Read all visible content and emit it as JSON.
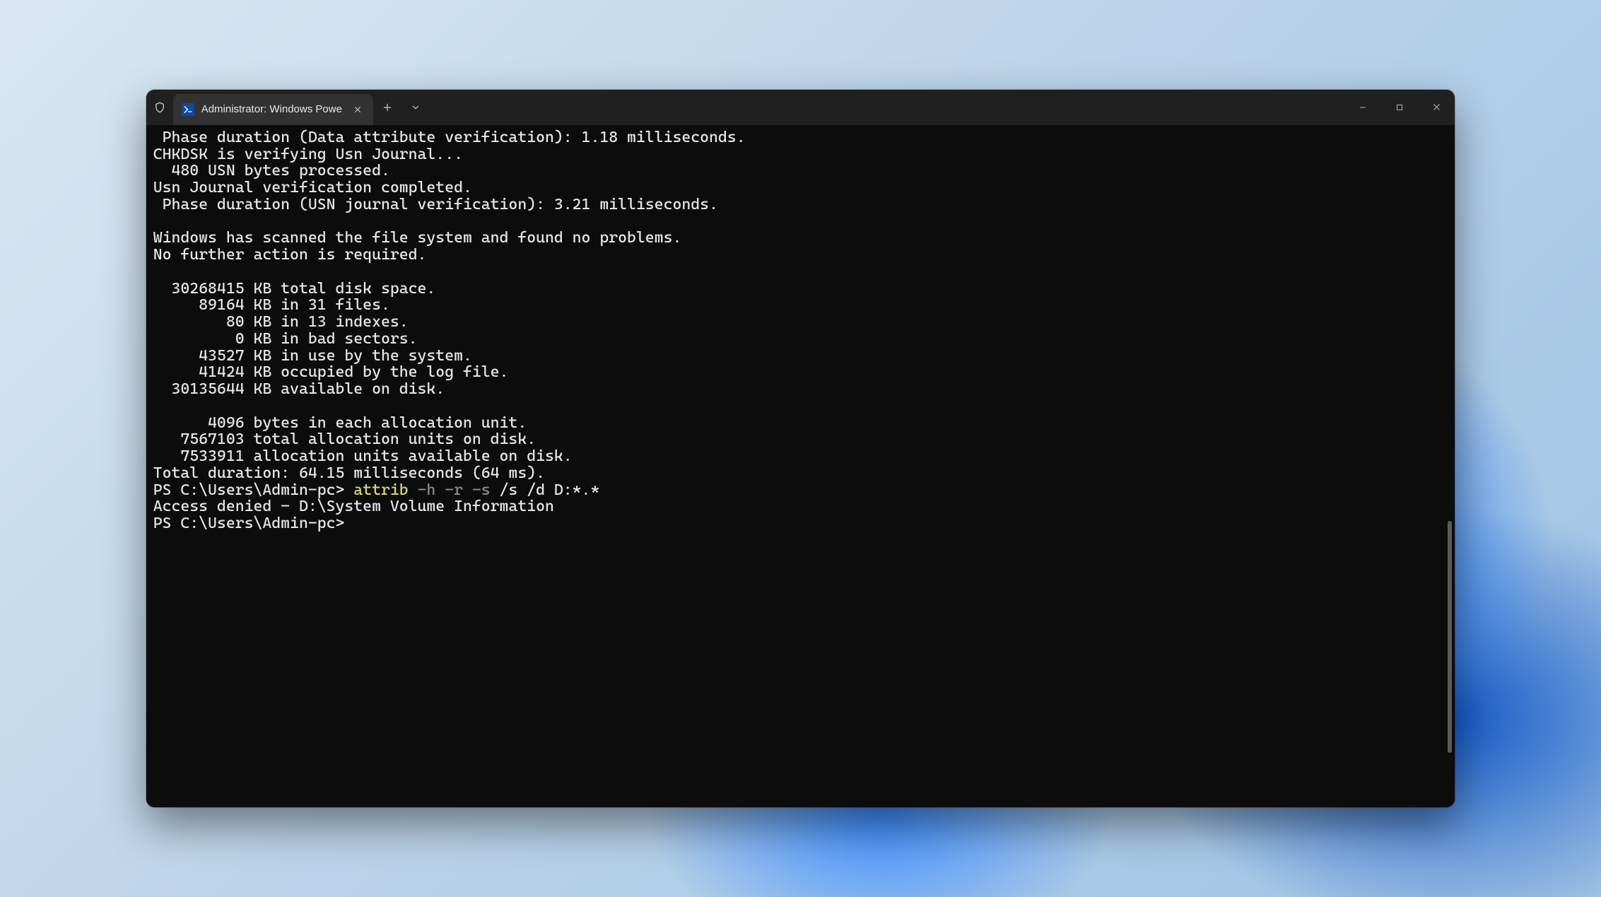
{
  "tab": {
    "title": "Administrator: Windows Powe"
  },
  "terminal": {
    "lines": [
      " Phase duration (Data attribute verification): 1.18 milliseconds.",
      "CHKDSK is verifying Usn Journal...",
      "  480 USN bytes processed.",
      "Usn Journal verification completed.",
      " Phase duration (USN journal verification): 3.21 milliseconds.",
      "",
      "Windows has scanned the file system and found no problems.",
      "No further action is required.",
      "",
      "  30268415 KB total disk space.",
      "     89164 KB in 31 files.",
      "        80 KB in 13 indexes.",
      "         0 KB in bad sectors.",
      "     43527 KB in use by the system.",
      "     41424 KB occupied by the log file.",
      "  30135644 KB available on disk.",
      "",
      "      4096 bytes in each allocation unit.",
      "   7567103 total allocation units on disk.",
      "   7533911 allocation units available on disk.",
      "Total duration: 64.15 milliseconds (64 ms)."
    ],
    "prompt1": {
      "ps": "PS C:\\Users\\Admin-pc> ",
      "cmd": "attrib",
      "flags": " -h -r -s",
      "rest": " /s /d D:*.*"
    },
    "resp1": "Access denied - D:\\System Volume Information",
    "prompt2": "PS C:\\Users\\Admin-pc> "
  }
}
